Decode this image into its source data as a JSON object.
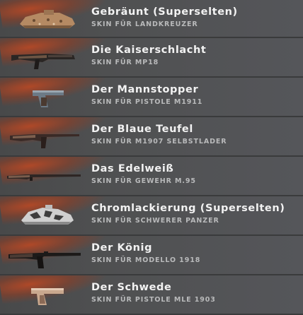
{
  "skins": [
    {
      "title": "Gebräunt (Superselten)",
      "subtitle": "SKIN FÜR LANDKREUZER",
      "icon": "tank-icon"
    },
    {
      "title": "Die Kaiserschlacht",
      "subtitle": "SKIN FÜR MP18",
      "icon": "smg-icon"
    },
    {
      "title": "Der Mannstopper",
      "subtitle": "SKIN FÜR PISTOLE M1911",
      "icon": "pistol-icon"
    },
    {
      "title": "Der Blaue Teufel",
      "subtitle": "SKIN FÜR M1907 SELBSTLADER",
      "icon": "rifle-icon"
    },
    {
      "title": "Das Edelweiß",
      "subtitle": "SKIN FÜR GEWEHR M.95",
      "icon": "rifle-icon"
    },
    {
      "title": "Chromlackierung (Superselten)",
      "subtitle": "SKIN FÜR SCHWERER PANZER",
      "icon": "tank-icon"
    },
    {
      "title": "Der König",
      "subtitle": "SKIN FÜR MODELLO 1918",
      "icon": "smg-icon"
    },
    {
      "title": "Der Schwede",
      "subtitle": "SKIN FÜR PISTOLE MLE 1903",
      "icon": "pistol-icon"
    }
  ],
  "colors": {
    "row_background": "#4f5051",
    "accent_glow": "#b44826",
    "title": "#f2f2f2",
    "subtitle": "#b9babb"
  }
}
